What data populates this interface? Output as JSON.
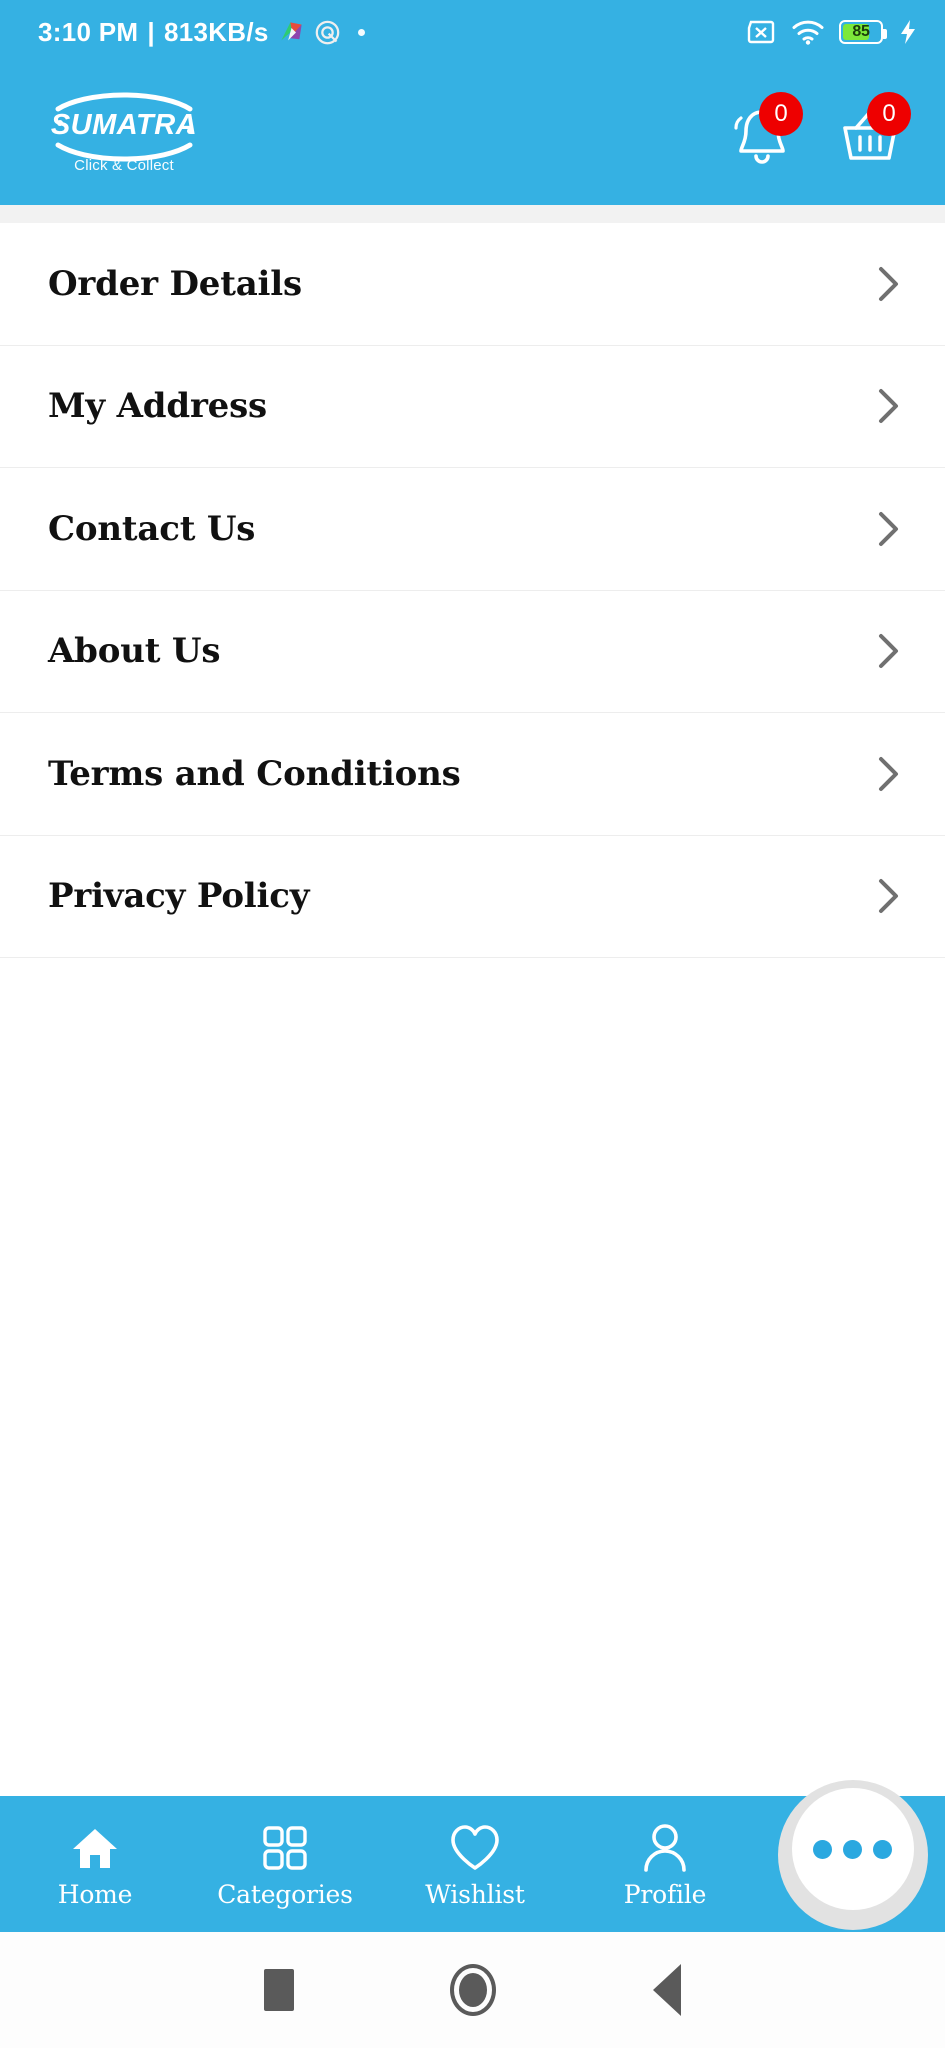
{
  "status_bar": {
    "time": "3:10 PM",
    "separator": "|",
    "network_speed": "813KB/s",
    "battery_percent": "85",
    "icons": [
      "app-icon-colorful",
      "app-icon-circle",
      "status-dot",
      "sim-off-icon",
      "wifi-icon",
      "battery-icon",
      "charging-bolt-icon"
    ]
  },
  "header": {
    "brand": "SUMATRA",
    "tagline": "Click & Collect",
    "notification_badge": "0",
    "cart_badge": "0",
    "background_color": "#35B1E3"
  },
  "menu": {
    "items": [
      {
        "label": "Order Details"
      },
      {
        "label": "My Address"
      },
      {
        "label": "Contact Us"
      },
      {
        "label": "About Us"
      },
      {
        "label": "Terms and Conditions"
      },
      {
        "label": "Privacy Policy"
      }
    ]
  },
  "bottom_nav": {
    "items": [
      {
        "label": "Home",
        "icon": "home-icon"
      },
      {
        "label": "Categories",
        "icon": "grid-icon"
      },
      {
        "label": "Wishlist",
        "icon": "heart-icon"
      },
      {
        "label": "Profile",
        "icon": "person-icon"
      }
    ],
    "fab": {
      "icon": "more-dots-icon",
      "dots": 3
    },
    "background_color": "#35B1E3"
  },
  "system_nav": {
    "buttons": [
      "recents-square-icon",
      "home-circle-icon",
      "back-triangle-icon"
    ]
  }
}
